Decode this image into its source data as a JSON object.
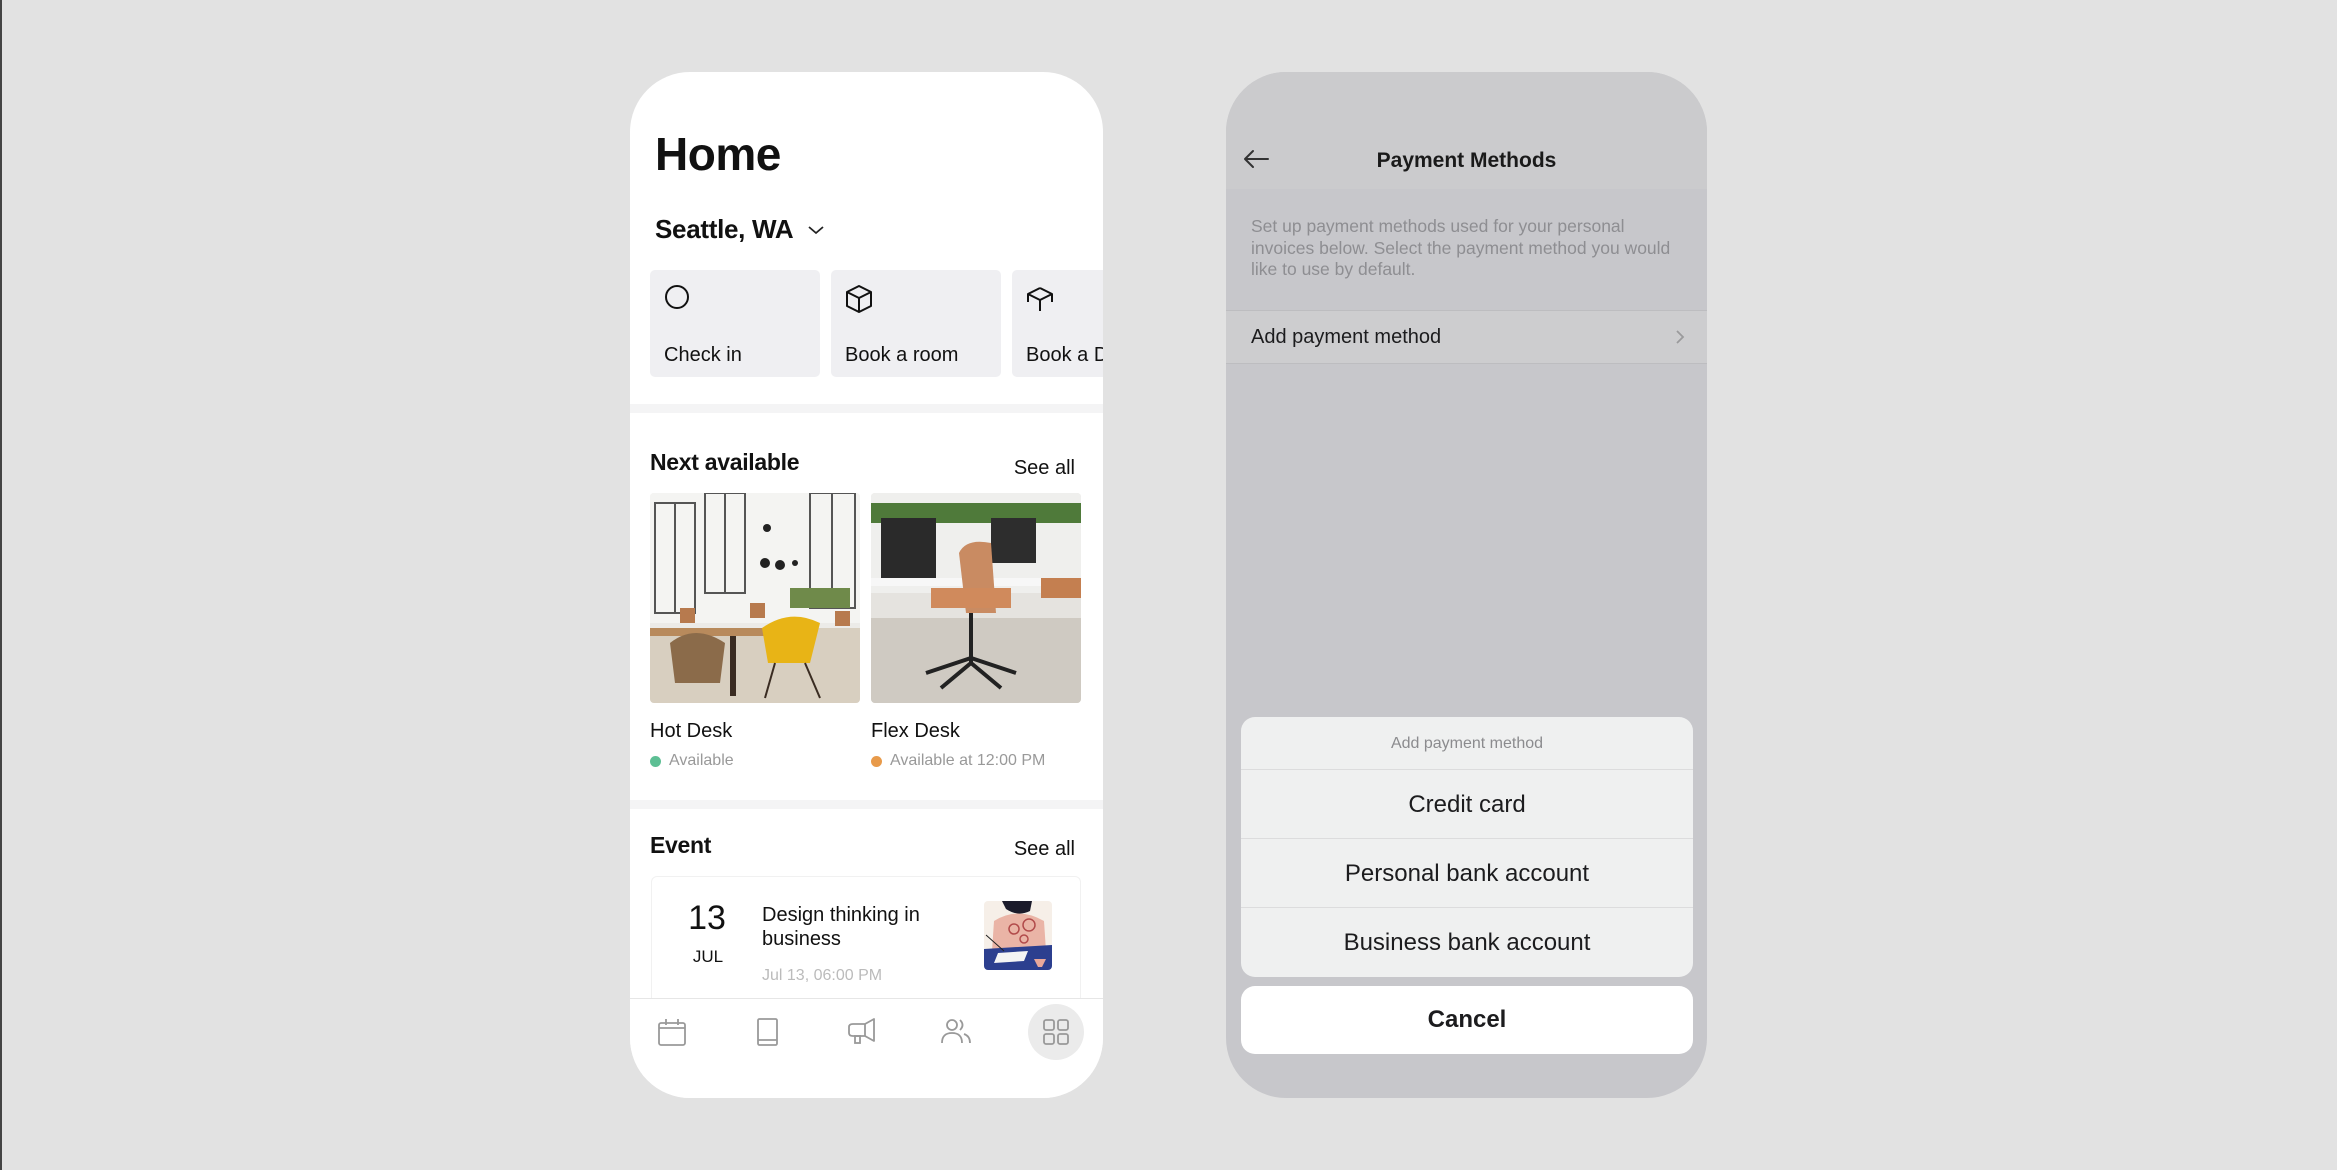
{
  "home": {
    "title": "Home",
    "location": "Seattle, WA",
    "quick_actions": [
      {
        "label": "Check in",
        "icon": "circle-icon"
      },
      {
        "label": "Book a room",
        "icon": "cube-icon"
      },
      {
        "label": "Book a D",
        "icon": "desk-icon"
      }
    ],
    "next_available": {
      "title": "Next available",
      "see_all": "See all",
      "items": [
        {
          "name": "Hot Desk",
          "status": "Available",
          "status_color": "#5dbf94"
        },
        {
          "name": "Flex Desk",
          "status": "Available at 12:00 PM",
          "status_color": "#e89a4a"
        }
      ]
    },
    "events": {
      "title": "Event",
      "see_all": "See all",
      "items": [
        {
          "day": "13",
          "month": "JUL",
          "title": "Design thinking in business",
          "time": "Jul 13, 06:00 PM"
        }
      ]
    },
    "tabbar": [
      {
        "icon": "calendar-icon",
        "active": false
      },
      {
        "icon": "book-icon",
        "active": false
      },
      {
        "icon": "megaphone-icon",
        "active": false
      },
      {
        "icon": "people-icon",
        "active": false
      },
      {
        "icon": "grid-icon",
        "active": true
      }
    ]
  },
  "payment": {
    "title": "Payment Methods",
    "description": "Set up payment methods used for your personal invoices below. Select the payment method you would like to use by default.",
    "add_row_label": "Add payment method",
    "sheet": {
      "title": "Add payment method",
      "options": [
        "Credit card",
        "Personal bank account",
        "Business bank account"
      ],
      "cancel": "Cancel"
    }
  }
}
